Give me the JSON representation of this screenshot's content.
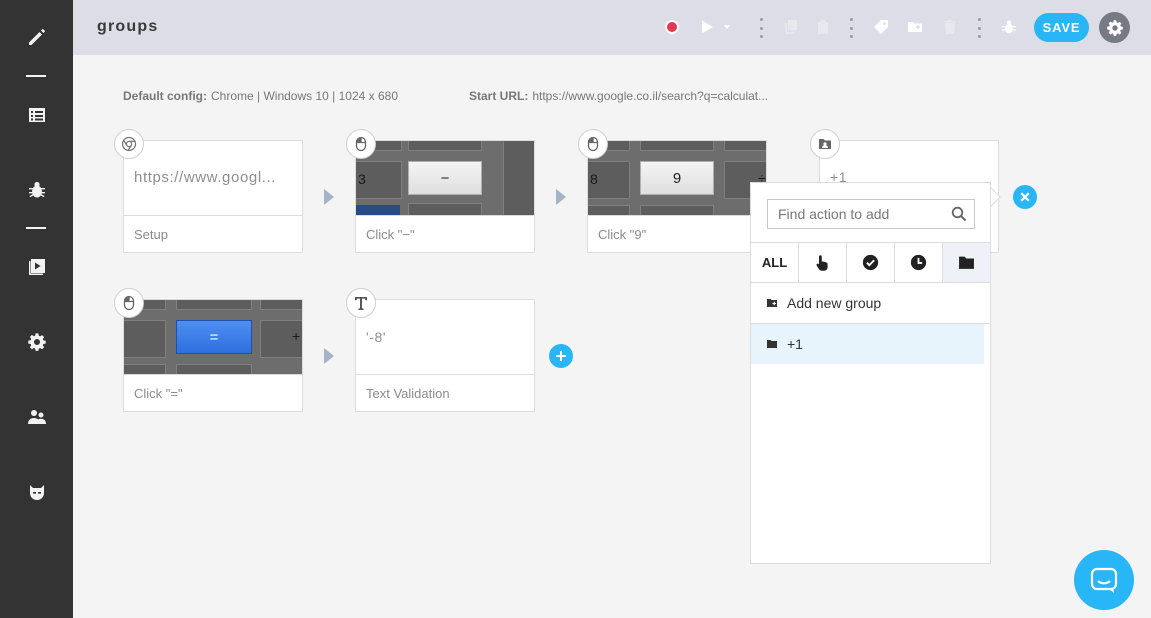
{
  "window": {
    "title": "groups"
  },
  "sidebar": {
    "items": [
      {
        "name": "pencil-icon"
      },
      {
        "name": "list-icon"
      },
      {
        "name": "bug-icon"
      },
      {
        "name": "play-square-icon"
      },
      {
        "name": "gear-icon"
      },
      {
        "name": "users-icon"
      },
      {
        "name": "mask-icon"
      }
    ]
  },
  "toolbar": {
    "save_label": "SAVE"
  },
  "config": {
    "default_label": "Default config:",
    "default_value": "Chrome | Windows 10 | 1024 x 680",
    "start_url_label": "Start URL:",
    "start_url_value": "https://www.google.co.il/search?q=calculat..."
  },
  "steps": [
    {
      "label": "Setup",
      "body": "https://www.googl...",
      "icon": "chrome-icon"
    },
    {
      "label": "Click \"−\"",
      "key": "−",
      "side_key": "3",
      "icon": "mouse-icon"
    },
    {
      "label": "Click \"9\"",
      "key": "9",
      "side_key": "8",
      "side_key_right": "÷",
      "icon": "mouse-icon"
    },
    {
      "label": "+1",
      "icon": "group-folder-icon"
    },
    {
      "label": "Click \"=\"",
      "key": "=",
      "side_key_right": "+",
      "icon": "mouse-icon"
    },
    {
      "label": "Text Validation",
      "body": "'-8'",
      "icon": "text-icon"
    }
  ],
  "popup": {
    "search_placeholder": "Find action to add",
    "tabs": [
      {
        "label": "ALL"
      },
      {
        "icon": "hand-pointer-icon"
      },
      {
        "icon": "check-circle-icon"
      },
      {
        "icon": "clock-icon"
      },
      {
        "icon": "folder-icon"
      }
    ],
    "add_group_label": "Add new group",
    "groups": [
      {
        "label": "+1"
      }
    ]
  },
  "colors": {
    "accent": "#29b6f6",
    "sidebar": "#333333",
    "topbar": "#dcdde6",
    "record": "#e53950"
  }
}
